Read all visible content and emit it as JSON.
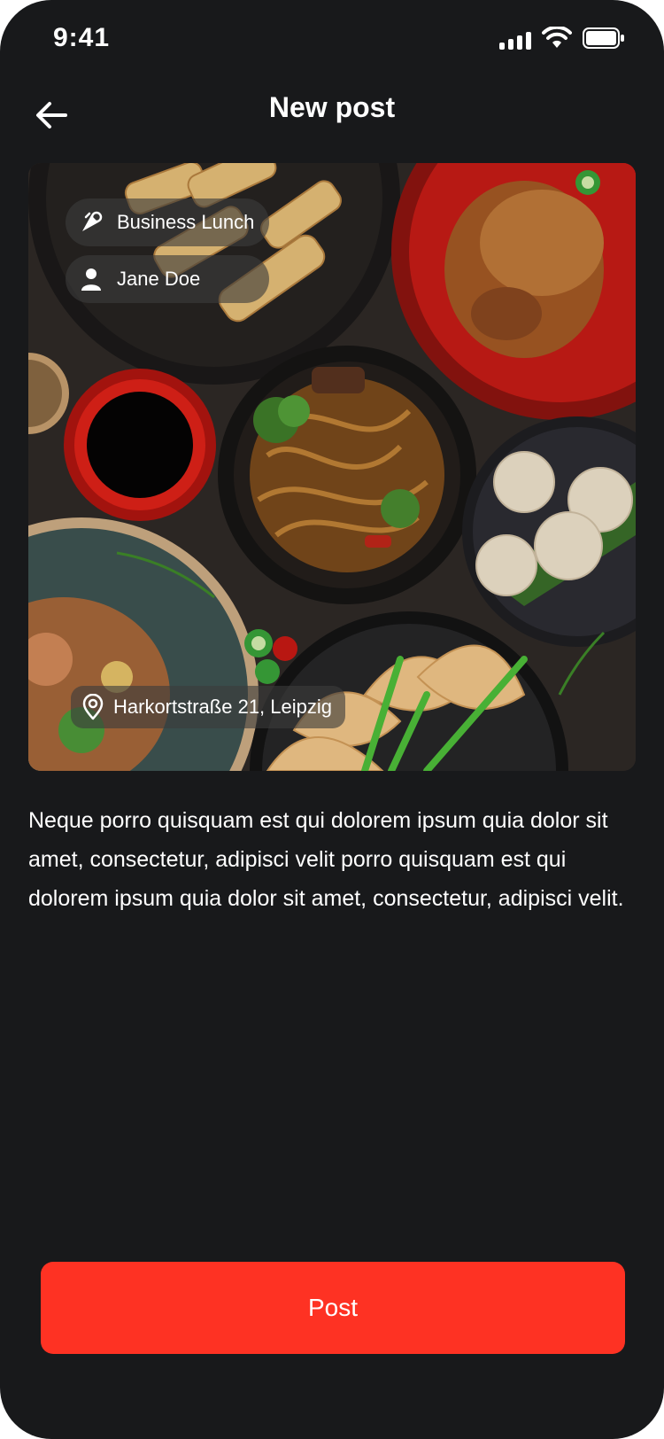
{
  "status_bar": {
    "time": "9:41",
    "icons": [
      "signal-icon",
      "wifi-icon",
      "battery-icon"
    ]
  },
  "header": {
    "title": "New post",
    "back_icon": "arrow-left-icon"
  },
  "photo": {
    "category_chip": {
      "label": "Business Lunch",
      "icon": "utensils-icon"
    },
    "user_chip": {
      "label": "Jane Doe",
      "icon": "user-icon"
    },
    "location_chip": {
      "label": "Harkortstraße 21, Leipzig",
      "icon": "map-pin-icon"
    }
  },
  "description": "Neque porro quisquam est qui dolorem ipsum quia dolor sit amet, consectetur, adipisci velit porro quisquam est qui dolorem ipsum quia dolor sit amet, consectetur, adipisci velit.",
  "post_button": {
    "label": "Post"
  },
  "colors": {
    "background": "#18191b",
    "accent": "#fe3223",
    "text": "#ffffff",
    "chip_background": "rgba(60,60,60,0.62)"
  }
}
